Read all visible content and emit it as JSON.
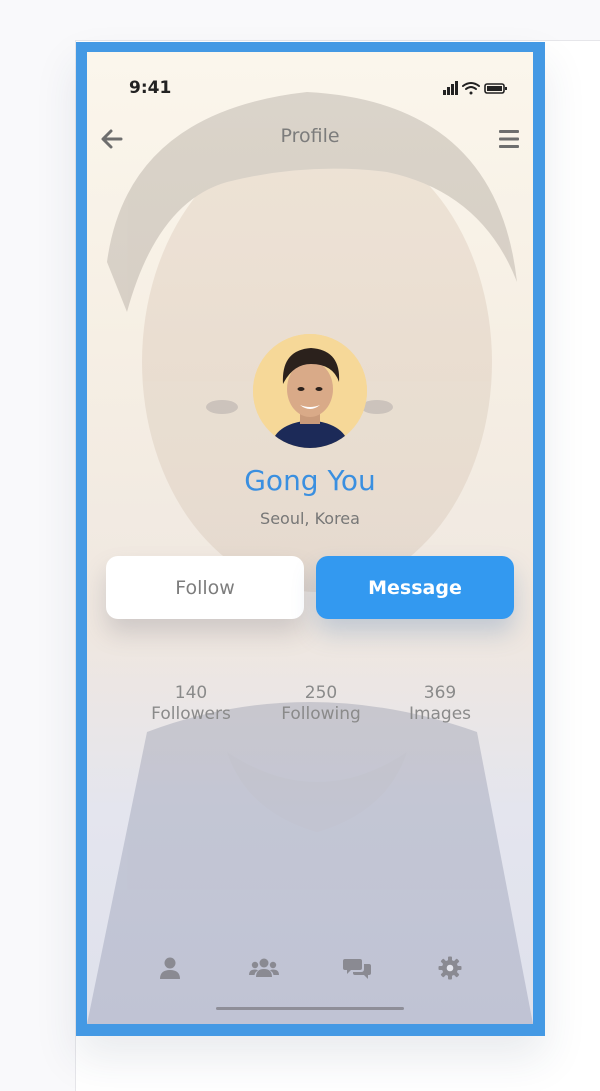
{
  "status_bar": {
    "time": "9:41"
  },
  "header": {
    "title": "Profile",
    "back_icon": "arrow-left-icon",
    "menu_icon": "hamburger-menu-icon"
  },
  "profile": {
    "name": "Gong You",
    "location": "Seoul, Korea"
  },
  "actions": {
    "follow_label": "Follow",
    "message_label": "Message"
  },
  "stats": [
    {
      "value": "140",
      "label": "Followers"
    },
    {
      "value": "250",
      "label": "Following"
    },
    {
      "value": "369",
      "label": "Images"
    }
  ],
  "tab_bar": {
    "icons": [
      "user-icon",
      "users-icon",
      "chat-bubbles-icon",
      "gear-icon"
    ]
  },
  "colors": {
    "frame": "#4499e4",
    "accent": "#3399f0",
    "name_text": "#3a8fe0",
    "muted_text": "#7c7c7c"
  }
}
